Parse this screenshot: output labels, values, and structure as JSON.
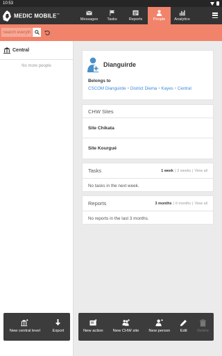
{
  "status_bar": {
    "time": "10:53"
  },
  "app": {
    "logo_text": "MEDIC MOBILE",
    "logo_tm": "™"
  },
  "nav": {
    "tabs": [
      {
        "label": "Messages",
        "icon": "envelope-icon"
      },
      {
        "label": "Tasks",
        "icon": "flag-icon"
      },
      {
        "label": "Reports",
        "icon": "report-icon"
      },
      {
        "label": "People",
        "icon": "person-icon",
        "active": true
      },
      {
        "label": "Analytics",
        "icon": "bar-chart-icon"
      }
    ]
  },
  "search": {
    "placeholder": "Search everyth"
  },
  "left_panel": {
    "header": "Central",
    "empty_text": "No more people"
  },
  "contact": {
    "name": "Dianguirde",
    "belongs_label": "Belongs to",
    "hierarchy": [
      "CSCOM Dianguirde",
      "District Diema",
      "Kayes",
      "Central"
    ],
    "separator": "•"
  },
  "chw_sites": {
    "title": "CHW Sites",
    "items": [
      "Site Chikata",
      "Site Kourgué"
    ]
  },
  "tasks": {
    "title": "Tasks",
    "filters": [
      "1 week",
      "2 weeks",
      "View all"
    ],
    "filter_sep": "|",
    "empty": "No tasks in the next week."
  },
  "reports": {
    "title": "Reports",
    "filters": [
      "3 months",
      "6 months",
      "View all"
    ],
    "filter_sep": "|",
    "empty": "No reports in the last 3 months."
  },
  "left_actions": [
    {
      "label": "New central level",
      "icon": "new-place-icon"
    },
    {
      "label": "Export",
      "icon": "export-icon"
    }
  ],
  "right_actions": [
    {
      "label": "New action",
      "icon": "new-action-icon"
    },
    {
      "label": "New CHW site",
      "icon": "new-site-icon"
    },
    {
      "label": "New person",
      "icon": "new-person-icon"
    },
    {
      "label": "Edit",
      "icon": "pencil-icon"
    },
    {
      "label": "Delete",
      "icon": "trash-icon",
      "disabled": true
    }
  ],
  "colors": {
    "accent": "#f2836b",
    "header": "#333333",
    "link": "#3b8ad8",
    "person_icon": "#4a90c8"
  }
}
